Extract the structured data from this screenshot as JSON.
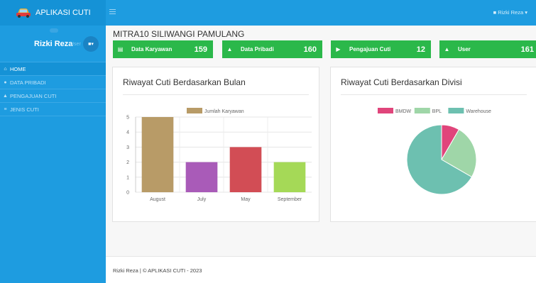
{
  "app": {
    "brand": "APLIKASI CUTI",
    "user_name": "Rizki Reza",
    "user_role": "User",
    "topbar_user": "Rizki Reza"
  },
  "nav": [
    {
      "label": "HOME",
      "icon": "home-icon",
      "active": true
    },
    {
      "label": "DATA PRIBADI",
      "icon": "user-icon",
      "active": false
    },
    {
      "label": "PENGAJUAN CUTI",
      "icon": "car-icon",
      "active": false
    },
    {
      "label": "JENIS CUTI",
      "icon": "list-icon",
      "active": false
    }
  ],
  "page_title": "MITRA10 SILIWANGI PAMULANG",
  "stats": [
    {
      "label": "Data Karyawan",
      "value": "159",
      "icon": "database-icon"
    },
    {
      "label": "Data Pribadi",
      "value": "160",
      "icon": "user-icon"
    },
    {
      "label": "Pengajuan Cuti",
      "value": "12",
      "icon": "car-icon"
    },
    {
      "label": "User",
      "value": "161",
      "icon": "user-icon"
    }
  ],
  "colors": {
    "accent": "#1e9ce0",
    "stat": "#2bb84a"
  },
  "footer": "Rizki Reza | © APLIKASI CUTI - 2023",
  "chart_data": [
    {
      "type": "bar",
      "title": "Riwayat Cuti Berdasarkan Bulan",
      "categories": [
        "August",
        "July",
        "May",
        "September"
      ],
      "series": [
        {
          "name": "Jumlah Karyawan",
          "values": [
            5,
            2,
            3,
            2
          ]
        }
      ],
      "bar_colors": [
        "#b89b67",
        "#a95bb8",
        "#d24d55",
        "#a5d957"
      ],
      "ylim": [
        0,
        5
      ],
      "yticks": [
        "0",
        "1",
        "2",
        "3",
        "4",
        "5"
      ],
      "legend": "top",
      "grid": true
    },
    {
      "type": "pie",
      "title": "Riwayat Cuti Berdasarkan Divisi",
      "labels": [
        "BMDW",
        "BPL",
        "Warehouse"
      ],
      "values": [
        1,
        3,
        8
      ],
      "colors": [
        "#e0457b",
        "#9fd6a8",
        "#6dc0b0"
      ],
      "legend": "top"
    }
  ]
}
